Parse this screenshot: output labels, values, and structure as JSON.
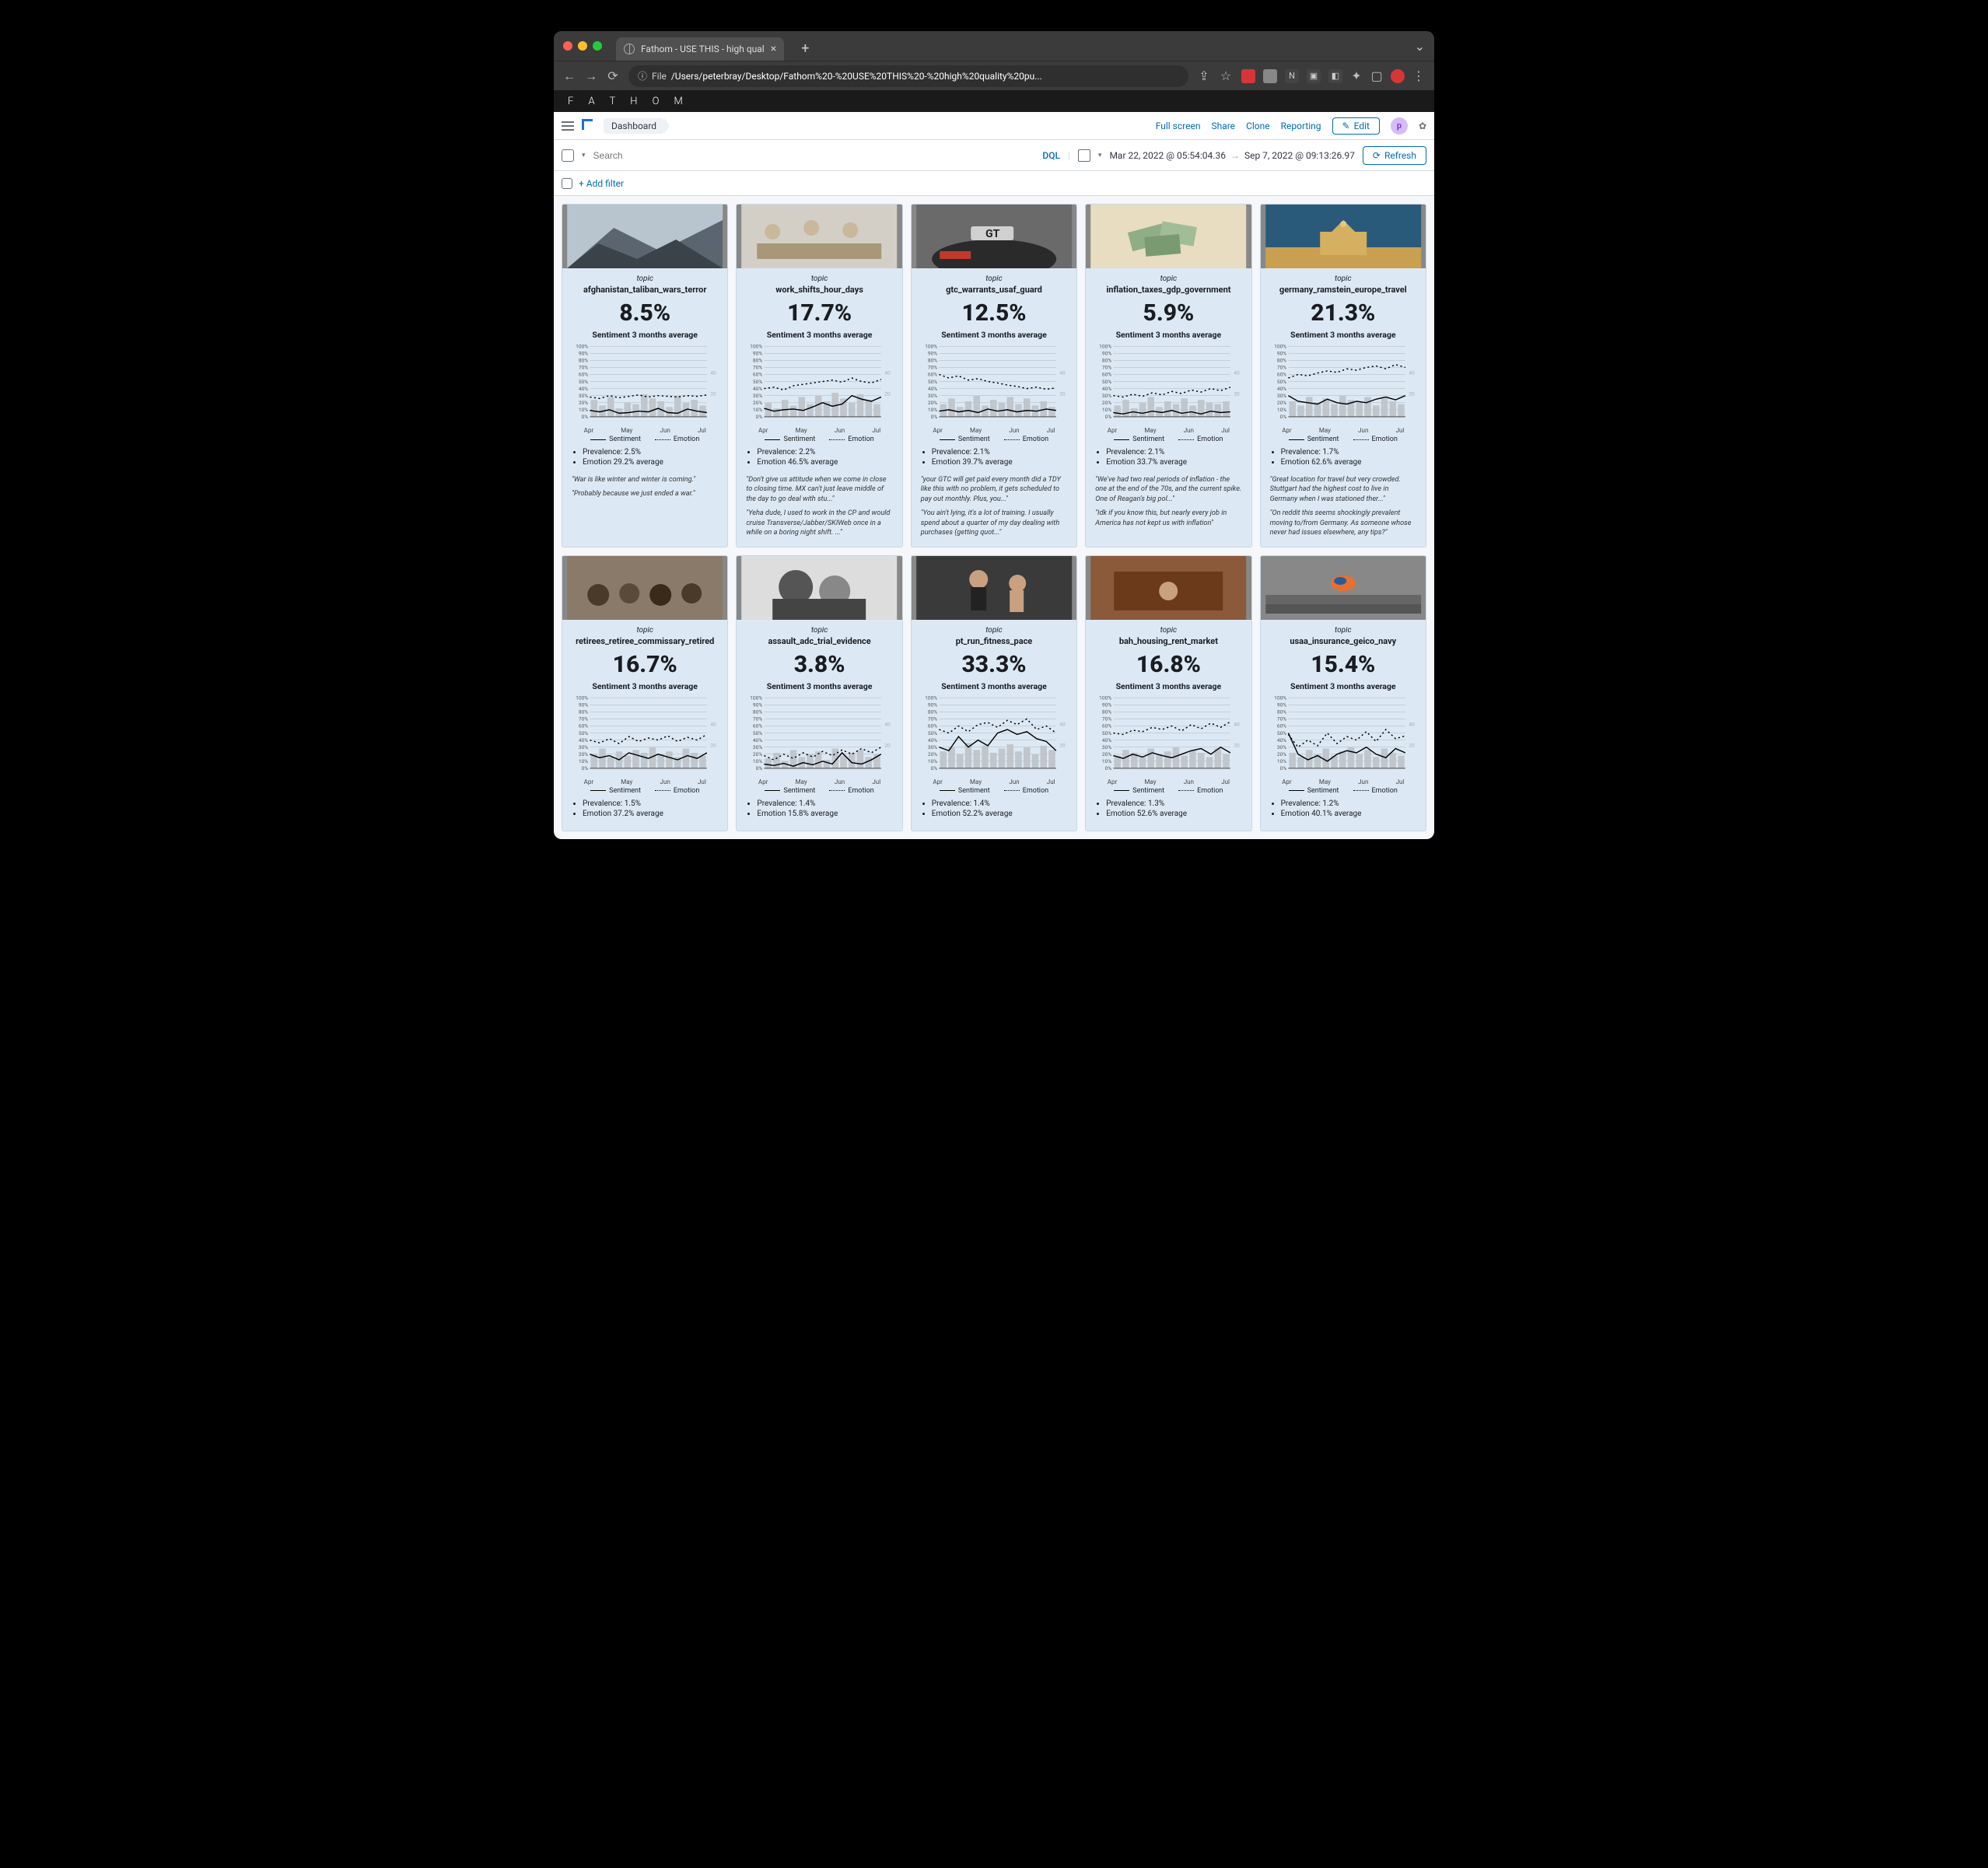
{
  "browser": {
    "tab_title": "Fathom - USE THIS - high qual",
    "url_prefix": "File",
    "url_path": "/Users/peterbray/Desktop/Fathom%20-%20USE%20THIS%20-%20high%20quality%20pu..."
  },
  "brand": "F A T H O M",
  "topbar": {
    "crumb": "Dashboard",
    "links": [
      "Full screen",
      "Share",
      "Clone",
      "Reporting"
    ],
    "edit": "Edit",
    "avatar": "p"
  },
  "search": {
    "placeholder": "Search",
    "dql": "DQL",
    "date_from": "Mar 22, 2022 @ 05:54:04.36",
    "date_to": "Sep 7, 2022 @ 09:13:26.97",
    "refresh": "Refresh"
  },
  "filterbar": {
    "add": "+ Add filter"
  },
  "labels": {
    "topic": "topic",
    "sentiment_sub": "Sentiment 3 months average",
    "legend_sentiment": "Sentiment",
    "legend_emotion": "Emotion",
    "months": [
      "Apr",
      "May",
      "Jun",
      "Jul"
    ],
    "yticks": [
      "100%",
      "90%",
      "80%",
      "70%",
      "60%",
      "50%",
      "40%",
      "30%",
      "20%",
      "10%",
      "0%"
    ]
  },
  "cards": [
    {
      "name": "afghanistan_taliban_wars_terror",
      "pct": "8.5%",
      "prev": "Prevalence: 2.5%",
      "emo": "Emotion 29.2% average",
      "quotes": [
        "\"War is like winter and winter is coming.\"",
        "\"Probably because we just ended a war.\""
      ],
      "img": "mountain",
      "sent": [
        9,
        7,
        10,
        5,
        6,
        8,
        7,
        12,
        6,
        5,
        11,
        8,
        6
      ],
      "emoL": [
        28,
        26,
        30,
        27,
        29,
        31,
        28,
        30,
        29,
        28,
        30,
        29,
        31
      ],
      "bars": [
        12,
        8,
        14,
        6,
        10,
        9,
        16,
        13,
        11,
        7,
        15,
        10,
        12,
        8
      ]
    },
    {
      "name": "work_shifts_hour_days",
      "pct": "17.7%",
      "prev": "Prevalence: 2.2%",
      "emo": "Emotion 46.5% average",
      "quotes": [
        "\"Don't give us attitude when we come in close to closing time. MX can't just leave middle of the day to go deal with stu...\"",
        "\"Yeha dude, I used to work in the CP and would cruise Transverse/Jabber/SKIWeb once in a while on a boring night shift. ...\""
      ],
      "img": "meeting",
      "sent": [
        12,
        8,
        10,
        11,
        9,
        14,
        20,
        15,
        18,
        30,
        25,
        22,
        28
      ],
      "emoL": [
        40,
        42,
        38,
        44,
        46,
        48,
        50,
        52,
        49,
        55,
        50,
        48,
        53
      ],
      "bars": [
        10,
        6,
        12,
        8,
        14,
        9,
        15,
        11,
        17,
        13,
        10,
        16,
        12,
        9
      ]
    },
    {
      "name": "gtc_warrants_usaf_guard",
      "pct": "12.5%",
      "prev": "Prevalence: 2.1%",
      "emo": "Emotion 39.7% average",
      "quotes": [
        "\"your GTC will get paid every month did a TDY like this with no problem, it gets scheduled to pay out monthly. Plus, you...\"",
        "\"You ain't lying, it's a lot of training. I usually spend about a quarter of my day dealing with purchases (getting quot...\""
      ],
      "img": "car",
      "sent": [
        8,
        10,
        7,
        9,
        6,
        11,
        8,
        10,
        7,
        9,
        8,
        11,
        9
      ],
      "emoL": [
        60,
        55,
        58,
        52,
        54,
        50,
        48,
        45,
        43,
        40,
        42,
        39,
        41
      ],
      "bars": [
        9,
        13,
        7,
        11,
        15,
        8,
        12,
        10,
        14,
        9,
        13,
        8,
        11,
        7
      ]
    },
    {
      "name": "inflation_taxes_gdp_government",
      "pct": "5.9%",
      "prev": "Prevalence: 2.1%",
      "emo": "Emotion 33.7% average",
      "quotes": [
        "\"We've had two real periods of inflation - the one at the end of the 70s, and the current spike. One of Reagan's big pol...\"",
        "\"Idk if you know this, but nearly every job in America has not kept us with inflation\""
      ],
      "img": "money",
      "sent": [
        6,
        4,
        7,
        5,
        8,
        6,
        9,
        5,
        7,
        4,
        8,
        6,
        7
      ],
      "emoL": [
        30,
        28,
        32,
        29,
        34,
        31,
        36,
        33,
        38,
        35,
        40,
        37,
        42
      ],
      "bars": [
        8,
        12,
        6,
        10,
        14,
        7,
        11,
        9,
        13,
        8,
        12,
        10,
        9,
        11
      ]
    },
    {
      "name": "germany_ramstein_europe_travel",
      "pct": "21.3%",
      "prev": "Prevalence: 1.7%",
      "emo": "Emotion 62.6% average",
      "quotes": [
        "\"Great location for travel but very crowded. Stuttgart had the highest cost to live in Germany when I was stationed ther...\"",
        "\"On reddit this seems shockingly prevalent moving to/from Germany. As someone whose never had issues elsewhere, any tips?\""
      ],
      "img": "gate",
      "sent": [
        30,
        22,
        20,
        18,
        25,
        20,
        18,
        22,
        20,
        25,
        28,
        24,
        30
      ],
      "emoL": [
        55,
        60,
        58,
        62,
        65,
        63,
        68,
        66,
        70,
        72,
        68,
        74,
        70
      ],
      "bars": [
        11,
        8,
        14,
        10,
        13,
        9,
        15,
        12,
        10,
        14,
        8,
        13,
        11,
        9
      ]
    },
    {
      "name": "retirees_retiree_commissary_retired",
      "pct": "16.7%",
      "prev": "Prevalence: 1.5%",
      "emo": "Emotion 37.2% average",
      "quotes": [],
      "img": "crowd",
      "sent": [
        20,
        15,
        18,
        12,
        22,
        18,
        14,
        20,
        16,
        12,
        18,
        14,
        22
      ],
      "emoL": [
        40,
        36,
        42,
        35,
        45,
        38,
        43,
        40,
        46,
        38,
        44,
        40,
        48
      ],
      "bars": [
        10,
        14,
        8,
        12,
        9,
        13,
        11,
        15,
        10,
        12,
        8,
        14,
        11,
        9
      ]
    },
    {
      "name": "assault_adc_trial_evidence",
      "pct": "3.8%",
      "prev": "Prevalence: 1.4%",
      "emo": "Emotion 15.8% average",
      "quotes": [],
      "img": "bw",
      "sent": [
        6,
        4,
        7,
        3,
        8,
        5,
        10,
        6,
        22,
        8,
        6,
        12,
        20
      ],
      "emoL": [
        18,
        12,
        20,
        14,
        22,
        16,
        24,
        18,
        26,
        20,
        28,
        22,
        30
      ],
      "bars": [
        7,
        11,
        5,
        13,
        8,
        10,
        12,
        6,
        14,
        9,
        11,
        13,
        8,
        10
      ]
    },
    {
      "name": "pt_run_fitness_pace",
      "pct": "33.3%",
      "prev": "Prevalence: 1.4%",
      "emo": "Emotion 52.2% average",
      "quotes": [],
      "img": "gym",
      "sent": [
        30,
        25,
        45,
        30,
        40,
        32,
        50,
        55,
        48,
        52,
        42,
        38,
        25
      ],
      "emoL": [
        55,
        50,
        60,
        52,
        62,
        65,
        58,
        68,
        62,
        70,
        55,
        60,
        50
      ],
      "bars": [
        12,
        15,
        10,
        18,
        13,
        16,
        11,
        14,
        17,
        12,
        15,
        10,
        16,
        13
      ]
    },
    {
      "name": "bah_housing_rent_market",
      "pct": "16.8%",
      "prev": "Prevalence: 1.3%",
      "emo": "Emotion 52.6% average",
      "quotes": [],
      "img": "court",
      "sent": [
        18,
        14,
        20,
        16,
        22,
        18,
        15,
        20,
        25,
        28,
        20,
        30,
        22
      ],
      "emoL": [
        50,
        48,
        54,
        52,
        58,
        55,
        60,
        53,
        62,
        56,
        64,
        58,
        66
      ],
      "bars": [
        9,
        13,
        11,
        8,
        14,
        10,
        12,
        15,
        9,
        13,
        11,
        8,
        14,
        10
      ]
    },
    {
      "name": "usaa_insurance_geico_navy",
      "pct": "15.4%",
      "prev": "Prevalence: 1.2%",
      "emo": "Emotion 40.1% average",
      "quotes": [],
      "img": "run",
      "sent": [
        50,
        20,
        12,
        18,
        10,
        20,
        25,
        22,
        30,
        20,
        15,
        28,
        22
      ],
      "emoL": [
        48,
        30,
        40,
        32,
        50,
        35,
        45,
        40,
        52,
        38,
        55,
        42,
        46
      ],
      "bars": [
        11,
        8,
        13,
        10,
        14,
        9,
        12,
        15,
        10,
        13,
        8,
        14,
        11,
        9
      ]
    }
  ],
  "chart_data": [
    {
      "type": "line",
      "title": "afghanistan_taliban_wars_terror",
      "ylabel": "%",
      "ylim": [
        0,
        100
      ],
      "x_months": [
        "Apr",
        "May",
        "Jun",
        "Jul"
      ],
      "series": [
        {
          "name": "Sentiment",
          "values": [
            9,
            7,
            10,
            5,
            6,
            8,
            7,
            12,
            6,
            5,
            11,
            8,
            6
          ]
        },
        {
          "name": "Emotion",
          "values": [
            28,
            26,
            30,
            27,
            29,
            31,
            28,
            30,
            29,
            28,
            30,
            29,
            31
          ]
        }
      ],
      "bars": [
        12,
        8,
        14,
        6,
        10,
        9,
        16,
        13,
        11,
        7,
        15,
        10,
        12,
        8
      ]
    },
    {
      "type": "line",
      "title": "work_shifts_hour_days",
      "ylabel": "%",
      "ylim": [
        0,
        100
      ],
      "x_months": [
        "Apr",
        "May",
        "Jun",
        "Jul"
      ],
      "series": [
        {
          "name": "Sentiment",
          "values": [
            12,
            8,
            10,
            11,
            9,
            14,
            20,
            15,
            18,
            30,
            25,
            22,
            28
          ]
        },
        {
          "name": "Emotion",
          "values": [
            40,
            42,
            38,
            44,
            46,
            48,
            50,
            52,
            49,
            55,
            50,
            48,
            53
          ]
        }
      ],
      "bars": [
        10,
        6,
        12,
        8,
        14,
        9,
        15,
        11,
        17,
        13,
        10,
        16,
        12,
        9
      ]
    },
    {
      "type": "line",
      "title": "gtc_warrants_usaf_guard",
      "ylabel": "%",
      "ylim": [
        0,
        100
      ],
      "x_months": [
        "Apr",
        "May",
        "Jun",
        "Jul"
      ],
      "series": [
        {
          "name": "Sentiment",
          "values": [
            8,
            10,
            7,
            9,
            6,
            11,
            8,
            10,
            7,
            9,
            8,
            11,
            9
          ]
        },
        {
          "name": "Emotion",
          "values": [
            60,
            55,
            58,
            52,
            54,
            50,
            48,
            45,
            43,
            40,
            42,
            39,
            41
          ]
        }
      ],
      "bars": [
        9,
        13,
        7,
        11,
        15,
        8,
        12,
        10,
        14,
        9,
        13,
        8,
        11,
        7
      ]
    },
    {
      "type": "line",
      "title": "inflation_taxes_gdp_government",
      "ylabel": "%",
      "ylim": [
        0,
        100
      ],
      "x_months": [
        "Apr",
        "May",
        "Jun",
        "Jul"
      ],
      "series": [
        {
          "name": "Sentiment",
          "values": [
            6,
            4,
            7,
            5,
            8,
            6,
            9,
            5,
            7,
            4,
            8,
            6,
            7
          ]
        },
        {
          "name": "Emotion",
          "values": [
            30,
            28,
            32,
            29,
            34,
            31,
            36,
            33,
            38,
            35,
            40,
            37,
            42
          ]
        }
      ],
      "bars": [
        8,
        12,
        6,
        10,
        14,
        7,
        11,
        9,
        13,
        8,
        12,
        10,
        9,
        11
      ]
    },
    {
      "type": "line",
      "title": "germany_ramstein_europe_travel",
      "ylabel": "%",
      "ylim": [
        0,
        100
      ],
      "x_months": [
        "Apr",
        "May",
        "Jun",
        "Jul"
      ],
      "series": [
        {
          "name": "Sentiment",
          "values": [
            30,
            22,
            20,
            18,
            25,
            20,
            18,
            22,
            20,
            25,
            28,
            24,
            30
          ]
        },
        {
          "name": "Emotion",
          "values": [
            55,
            60,
            58,
            62,
            65,
            63,
            68,
            66,
            70,
            72,
            68,
            74,
            70
          ]
        }
      ],
      "bars": [
        11,
        8,
        14,
        10,
        13,
        9,
        15,
        12,
        10,
        14,
        8,
        13,
        11,
        9
      ]
    },
    {
      "type": "line",
      "title": "retirees_retiree_commissary_retired",
      "ylabel": "%",
      "ylim": [
        0,
        100
      ],
      "x_months": [
        "Apr",
        "May",
        "Jun",
        "Jul"
      ],
      "series": [
        {
          "name": "Sentiment",
          "values": [
            20,
            15,
            18,
            12,
            22,
            18,
            14,
            20,
            16,
            12,
            18,
            14,
            22
          ]
        },
        {
          "name": "Emotion",
          "values": [
            40,
            36,
            42,
            35,
            45,
            38,
            43,
            40,
            46,
            38,
            44,
            40,
            48
          ]
        }
      ],
      "bars": [
        10,
        14,
        8,
        12,
        9,
        13,
        11,
        15,
        10,
        12,
        8,
        14,
        11,
        9
      ]
    },
    {
      "type": "line",
      "title": "assault_adc_trial_evidence",
      "ylabel": "%",
      "ylim": [
        0,
        100
      ],
      "x_months": [
        "Apr",
        "May",
        "Jun",
        "Jul"
      ],
      "series": [
        {
          "name": "Sentiment",
          "values": [
            6,
            4,
            7,
            3,
            8,
            5,
            10,
            6,
            22,
            8,
            6,
            12,
            20
          ]
        },
        {
          "name": "Emotion",
          "values": [
            18,
            12,
            20,
            14,
            22,
            16,
            24,
            18,
            26,
            20,
            28,
            22,
            30
          ]
        }
      ],
      "bars": [
        7,
        11,
        5,
        13,
        8,
        10,
        12,
        6,
        14,
        9,
        11,
        13,
        8,
        10
      ]
    },
    {
      "type": "line",
      "title": "pt_run_fitness_pace",
      "ylabel": "%",
      "ylim": [
        0,
        100
      ],
      "x_months": [
        "Apr",
        "May",
        "Jun",
        "Jul"
      ],
      "series": [
        {
          "name": "Sentiment",
          "values": [
            30,
            25,
            45,
            30,
            40,
            32,
            50,
            55,
            48,
            52,
            42,
            38,
            25
          ]
        },
        {
          "name": "Emotion",
          "values": [
            55,
            50,
            60,
            52,
            62,
            65,
            58,
            68,
            62,
            70,
            55,
            60,
            50
          ]
        }
      ],
      "bars": [
        12,
        15,
        10,
        18,
        13,
        16,
        11,
        14,
        17,
        12,
        15,
        10,
        16,
        13
      ]
    },
    {
      "type": "line",
      "title": "bah_housing_rent_market",
      "ylabel": "%",
      "ylim": [
        0,
        100
      ],
      "x_months": [
        "Apr",
        "May",
        "Jun",
        "Jul"
      ],
      "series": [
        {
          "name": "Sentiment",
          "values": [
            18,
            14,
            20,
            16,
            22,
            18,
            15,
            20,
            25,
            28,
            20,
            30,
            22
          ]
        },
        {
          "name": "Emotion",
          "values": [
            50,
            48,
            54,
            52,
            58,
            55,
            60,
            53,
            62,
            56,
            64,
            58,
            66
          ]
        }
      ],
      "bars": [
        9,
        13,
        11,
        8,
        14,
        10,
        12,
        15,
        9,
        13,
        11,
        8,
        14,
        10
      ]
    },
    {
      "type": "line",
      "title": "usaa_insurance_geico_navy",
      "ylabel": "%",
      "ylim": [
        0,
        100
      ],
      "x_months": [
        "Apr",
        "May",
        "Jun",
        "Jul"
      ],
      "series": [
        {
          "name": "Sentiment",
          "values": [
            50,
            20,
            12,
            18,
            10,
            20,
            25,
            22,
            30,
            20,
            15,
            28,
            22
          ]
        },
        {
          "name": "Emotion",
          "values": [
            48,
            30,
            40,
            32,
            50,
            35,
            45,
            40,
            52,
            38,
            55,
            42,
            46
          ]
        }
      ],
      "bars": [
        11,
        8,
        13,
        10,
        14,
        9,
        12,
        15,
        10,
        13,
        8,
        14,
        11,
        9
      ]
    }
  ]
}
